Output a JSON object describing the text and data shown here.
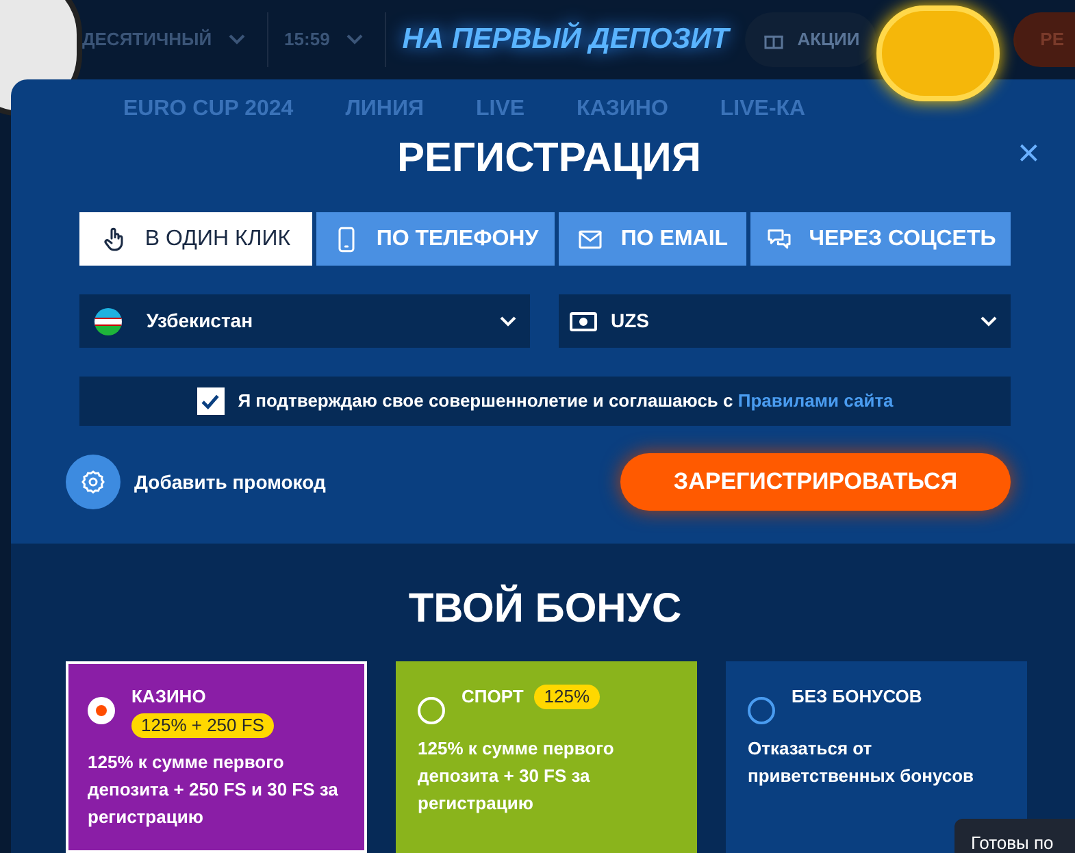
{
  "site_header": {
    "odds_format": "ДЕСЯТИЧНЫЙ",
    "time": "15:59",
    "promo_banner": "НА ПЕРВЫЙ ДЕПОЗИТ",
    "promotions": "АКЦИИ",
    "register_cut": "РЕ"
  },
  "background_nav": [
    "EURO CUP 2024",
    "ЛИНИЯ",
    "LIVE",
    "КАЗИНО",
    "LIVE-КА"
  ],
  "modal": {
    "title": "РЕГИСТРАЦИЯ",
    "close": "×",
    "tabs": [
      {
        "label": "В ОДИН КЛИК",
        "kind": "one_click",
        "selected": true
      },
      {
        "label": "ПО ТЕЛЕФОНУ",
        "kind": "phone",
        "selected": false
      },
      {
        "label": "ПО EMAIL",
        "kind": "email",
        "selected": false
      },
      {
        "label": "ЧЕРЕЗ СОЦСЕТЬ",
        "kind": "social",
        "selected": false
      }
    ],
    "country": {
      "value": "Узбекистан"
    },
    "currency": {
      "value": "UZS"
    },
    "agreement": {
      "checked": true,
      "text": "Я подтверждаю свое совершеннолетие и соглашаюсь с",
      "link": "Правилами сайта"
    },
    "promo_code": "Добавить промокод",
    "submit": "ЗАРЕГИСТРИРОВАТЬСЯ",
    "bonus_title": "ТВОЙ БОНУС",
    "bonuses": [
      {
        "kind": "casino",
        "title": "КАЗИНО",
        "badge": "125% + 250 FS",
        "description": "125% к сумме первого депозита + 250 FS и 30 FS за регистрацию",
        "selected": true
      },
      {
        "kind": "sport",
        "title": "СПОРТ",
        "badge": "125%",
        "description": "125% к сумме первого депозита + 30 FS за регистрацию",
        "selected": false
      },
      {
        "kind": "none",
        "title": "БЕЗ БОНУСОВ",
        "description": "Отказаться от приветственных бонусов",
        "selected": false
      }
    ]
  },
  "chat_tooltip": "Готовы по"
}
